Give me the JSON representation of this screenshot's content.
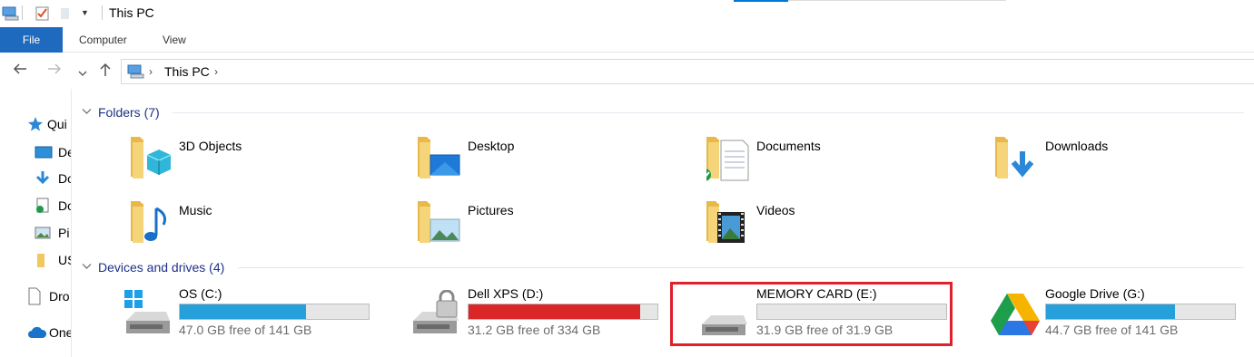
{
  "window": {
    "title": "This PC"
  },
  "ribbon": {
    "tabs": [
      {
        "label": "File"
      },
      {
        "label": "Computer"
      },
      {
        "label": "View"
      }
    ]
  },
  "address": {
    "segments": [
      "This PC"
    ]
  },
  "sidebar": {
    "items": [
      {
        "label": "Quick access",
        "visible_label": "Qui",
        "icon": "star-icon"
      },
      {
        "label": "Desktop",
        "visible_label": "De",
        "icon": "desktop-icon"
      },
      {
        "label": "Downloads",
        "visible_label": "Do",
        "icon": "download-icon"
      },
      {
        "label": "Documents",
        "visible_label": "Do",
        "icon": "document-icon"
      },
      {
        "label": "Pictures",
        "visible_label": "Pi",
        "icon": "pictures-icon"
      },
      {
        "label": "US",
        "visible_label": "US",
        "icon": "folder-icon"
      },
      {
        "label": "Dropbox",
        "visible_label": "Dro",
        "icon": "page-icon"
      },
      {
        "label": "OneDrive",
        "visible_label": "One",
        "icon": "cloud-icon"
      }
    ]
  },
  "folders": {
    "header": "Folders (7)",
    "items": [
      {
        "name": "3D Objects",
        "icon": "3d-objects-icon"
      },
      {
        "name": "Desktop",
        "icon": "desktop-folder-icon"
      },
      {
        "name": "Documents",
        "icon": "documents-folder-icon"
      },
      {
        "name": "Downloads",
        "icon": "downloads-folder-icon"
      },
      {
        "name": "Music",
        "icon": "music-folder-icon"
      },
      {
        "name": "Pictures",
        "icon": "pictures-folder-icon"
      },
      {
        "name": "Videos",
        "icon": "videos-folder-icon"
      }
    ]
  },
  "drives": {
    "header": "Devices and drives (4)",
    "items": [
      {
        "name": "OS (C:)",
        "free": "47.0 GB free of 141 GB",
        "used_fraction": 0.667,
        "bar_color": "#26a0da",
        "icon": "windows-drive-icon"
      },
      {
        "name": "Dell XPS (D:)",
        "free": "31.2 GB free of 334 GB",
        "used_fraction": 0.907,
        "bar_color": "#da2626",
        "icon": "locked-drive-icon"
      },
      {
        "name": "MEMORY CARD (E:)",
        "free": "31.9 GB free of 31.9 GB",
        "used_fraction": 0.0,
        "bar_color": "#26a0da",
        "icon": "memory-card-drive-icon"
      },
      {
        "name": "Google Drive (G:)",
        "free": "44.7 GB free of 141 GB",
        "used_fraction": 0.683,
        "bar_color": "#26a0da",
        "icon": "google-drive-icon"
      }
    ]
  },
  "colors": {
    "accent": "#1e6abf",
    "group_header": "#1e3287",
    "highlight": "#e0202a"
  }
}
